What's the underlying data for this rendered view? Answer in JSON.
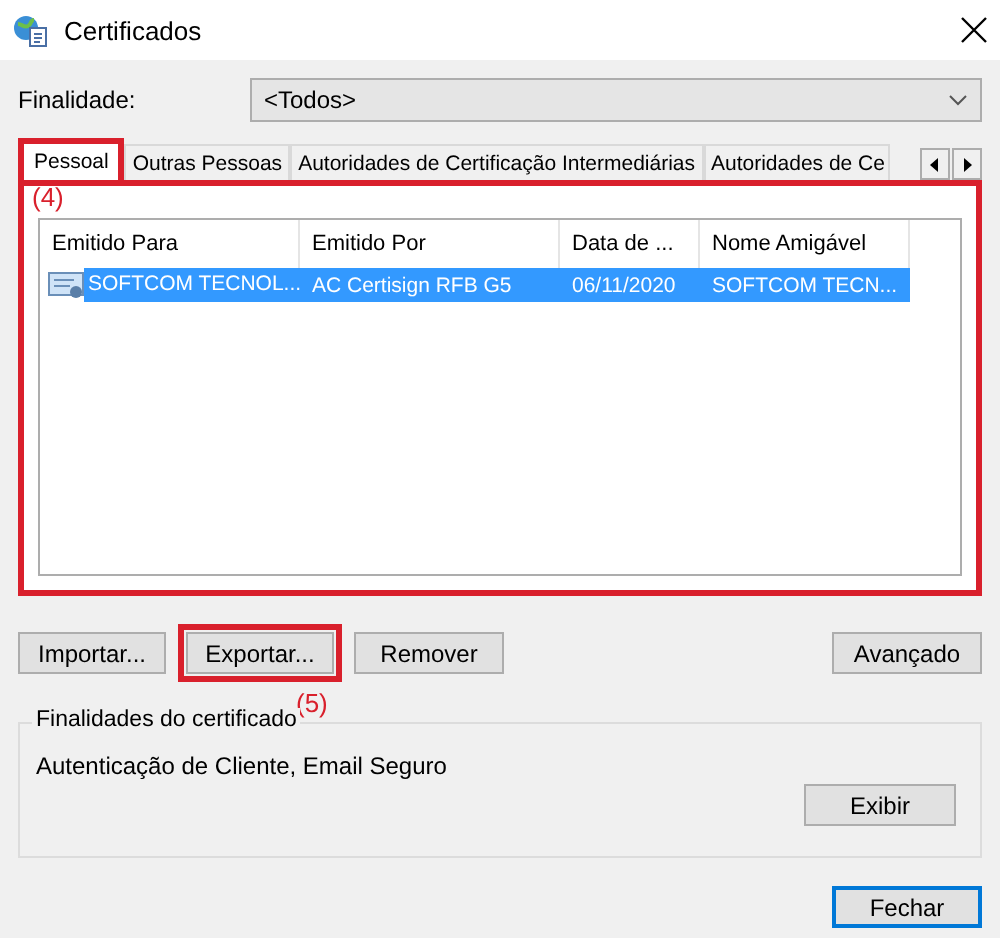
{
  "window": {
    "title": "Certificados"
  },
  "purpose": {
    "label": "Finalidade:",
    "value": "<Todos>"
  },
  "tabs": [
    {
      "label": "Pessoal",
      "selected": true
    },
    {
      "label": "Outras Pessoas",
      "selected": false
    },
    {
      "label": "Autoridades de Certificação Intermediárias",
      "selected": false
    },
    {
      "label": "Autoridades de Ce",
      "selected": false
    }
  ],
  "tab_panel": {
    "highlighted": true,
    "annotation": "(4)"
  },
  "table": {
    "columns": [
      "Emitido Para",
      "Emitido Por",
      "Data de ...",
      "Nome Amigável"
    ],
    "rows": [
      {
        "cells": [
          "SOFTCOM TECNOL...",
          "AC Certisign RFB G5",
          "06/11/2020",
          "SOFTCOM TECN..."
        ],
        "selected": true
      }
    ]
  },
  "actions": [
    {
      "label": "Importar...",
      "highlighted": false
    },
    {
      "label": "Exportar...",
      "highlighted": true,
      "annotation": "(5)"
    },
    {
      "label": "Remover",
      "highlighted": false
    }
  ],
  "advanced_button": "Avançado",
  "purposes_group": {
    "title": "Finalidades do certificado",
    "text": "Autenticação de Cliente, Email Seguro",
    "button": "Exibir"
  },
  "close_button": "Fechar"
}
